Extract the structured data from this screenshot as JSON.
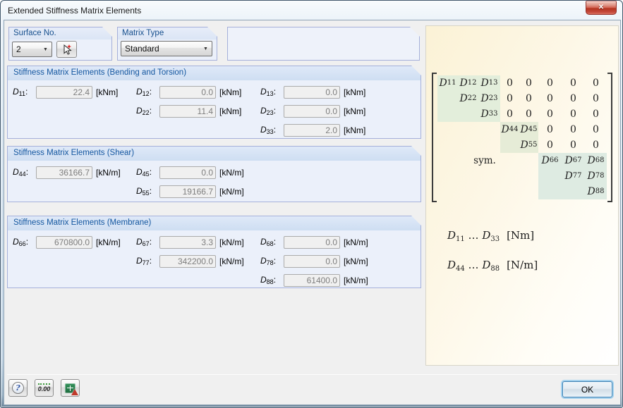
{
  "window": {
    "title": "Extended Stiffness Matrix Elements"
  },
  "icons": {
    "close_glyph": "✕",
    "combo_arrow": "▼",
    "help_glyph": "?"
  },
  "controls": {
    "surface": {
      "label": "Surface No.",
      "value": "2"
    },
    "matrix_type": {
      "label": "Matrix Type",
      "value": "Standard"
    }
  },
  "sections": [
    {
      "title": "Stiffness Matrix Elements (Bending and Torsion)",
      "rows": [
        [
          {
            "label": "D11",
            "value": "22.4",
            "unit": "[kNm]"
          },
          {
            "label": "D12",
            "value": "0.0",
            "unit": "[kNm]"
          },
          {
            "label": "D13",
            "value": "0.0",
            "unit": "[kNm]"
          }
        ],
        [
          null,
          {
            "label": "D22",
            "value": "11.4",
            "unit": "[kNm]"
          },
          {
            "label": "D23",
            "value": "0.0",
            "unit": "[kNm]"
          }
        ],
        [
          null,
          null,
          {
            "label": "D33",
            "value": "2.0",
            "unit": "[kNm]"
          }
        ]
      ]
    },
    {
      "title": "Stiffness Matrix Elements (Shear)",
      "rows": [
        [
          {
            "label": "D44",
            "value": "36166.7",
            "unit": "[kN/m]"
          },
          {
            "label": "D45",
            "value": "0.0",
            "unit": "[kN/m]"
          },
          null
        ],
        [
          null,
          {
            "label": "D55",
            "value": "19166.7",
            "unit": "[kN/m]"
          },
          null
        ]
      ]
    },
    {
      "title": "Stiffness Matrix Elements (Membrane)",
      "rows": [
        [
          {
            "label": "D66",
            "value": "670800.0",
            "unit": "[kN/m]"
          },
          {
            "label": "D67",
            "value": "3.3",
            "unit": "[kN/m]"
          },
          {
            "label": "D68",
            "value": "0.0",
            "unit": "[kN/m]"
          }
        ],
        [
          null,
          {
            "label": "D77",
            "value": "342200.0",
            "unit": "[kN/m]"
          },
          {
            "label": "D78",
            "value": "0.0",
            "unit": "[kN/m]"
          }
        ],
        [
          null,
          null,
          {
            "label": "D88",
            "value": "61400.0",
            "unit": "[kN/m]"
          }
        ]
      ]
    }
  ],
  "panel": {
    "matrix": {
      "rows": [
        [
          "D11",
          "D12",
          "D13",
          "0",
          "0",
          "0",
          "0",
          "0"
        ],
        [
          "",
          "D22",
          "D23",
          "0",
          "0",
          "0",
          "0",
          "0"
        ],
        [
          "",
          "",
          "D33",
          "0",
          "0",
          "0",
          "0",
          "0"
        ],
        [
          "",
          "",
          "",
          "D44",
          "D45",
          "0",
          "0",
          "0"
        ],
        [
          "",
          "",
          "",
          "",
          "D55",
          "0",
          "0",
          "0"
        ],
        [
          "",
          "",
          "",
          "",
          "",
          "D66",
          "D67",
          "D68"
        ],
        [
          "",
          "",
          "",
          "",
          "",
          "",
          "D77",
          "D78"
        ],
        [
          "",
          "",
          "",
          "",
          "",
          "",
          "",
          "D88"
        ]
      ],
      "sym_label": "sym."
    },
    "block_colors": {
      "bending": "#e3eedb",
      "shear": "#e6ecd7",
      "membrane": "#deebe2"
    },
    "legend": [
      {
        "symbols": "D11 … D33",
        "unit": "[Nm]"
      },
      {
        "symbols": "D44 … D88",
        "unit": "[N/m]"
      }
    ]
  },
  "footer": {
    "ok_label": "OK",
    "units_icon_text": "0.00"
  }
}
